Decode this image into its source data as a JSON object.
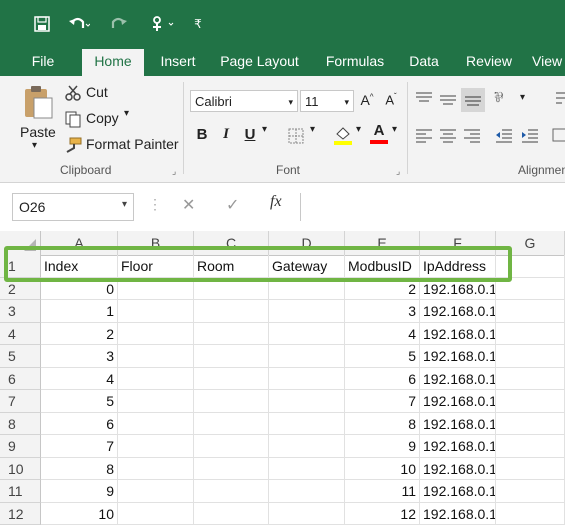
{
  "colors": {
    "brand": "#217346",
    "highlight": "#70b544",
    "ribbon_bg": "#f3f3f3"
  },
  "quick_access": {
    "save_icon": "save-icon",
    "undo_icon": "undo-icon",
    "redo_icon": "redo-icon",
    "touch_icon": "touch-mode-icon",
    "customize_icon": "customize-icon"
  },
  "tabs": [
    "File",
    "Home",
    "Insert",
    "Page Layout",
    "Formulas",
    "Data",
    "Review",
    "View"
  ],
  "active_tab": "Home",
  "clipboard": {
    "paste": "Paste",
    "cut": "Cut",
    "copy": "Copy",
    "format_painter": "Format Painter",
    "group": "Clipboard"
  },
  "font": {
    "name": "Calibri",
    "size": "11",
    "bold": "B",
    "italic": "I",
    "underline": "U",
    "group": "Font",
    "color_label": "A"
  },
  "alignment": {
    "group": "Alignmen"
  },
  "formula_bar": {
    "name_box": "O26",
    "fx": "fx",
    "cancel": "✕",
    "enter": "✓",
    "value": ""
  },
  "columns": [
    "A",
    "B",
    "C",
    "D",
    "E",
    "F",
    "G"
  ],
  "header_row": {
    "row": "1",
    "cells": [
      "Index",
      "Floor",
      "Room",
      "Gateway",
      "ModbusID",
      "IpAddress",
      ""
    ]
  },
  "rows": [
    {
      "row": "2",
      "index": "0",
      "modbus": "2",
      "ip": "192.168.0.1"
    },
    {
      "row": "3",
      "index": "1",
      "modbus": "3",
      "ip": "192.168.0.1"
    },
    {
      "row": "4",
      "index": "2",
      "modbus": "4",
      "ip": "192.168.0.1"
    },
    {
      "row": "5",
      "index": "3",
      "modbus": "5",
      "ip": "192.168.0.1"
    },
    {
      "row": "6",
      "index": "4",
      "modbus": "6",
      "ip": "192.168.0.1"
    },
    {
      "row": "7",
      "index": "5",
      "modbus": "7",
      "ip": "192.168.0.1"
    },
    {
      "row": "8",
      "index": "6",
      "modbus": "8",
      "ip": "192.168.0.1"
    },
    {
      "row": "9",
      "index": "7",
      "modbus": "9",
      "ip": "192.168.0.1"
    },
    {
      "row": "10",
      "index": "8",
      "modbus": "10",
      "ip": "192.168.0.1"
    },
    {
      "row": "11",
      "index": "9",
      "modbus": "11",
      "ip": "192.168.0.1"
    },
    {
      "row": "12",
      "index": "10",
      "modbus": "12",
      "ip": "192.168.0.1"
    }
  ]
}
